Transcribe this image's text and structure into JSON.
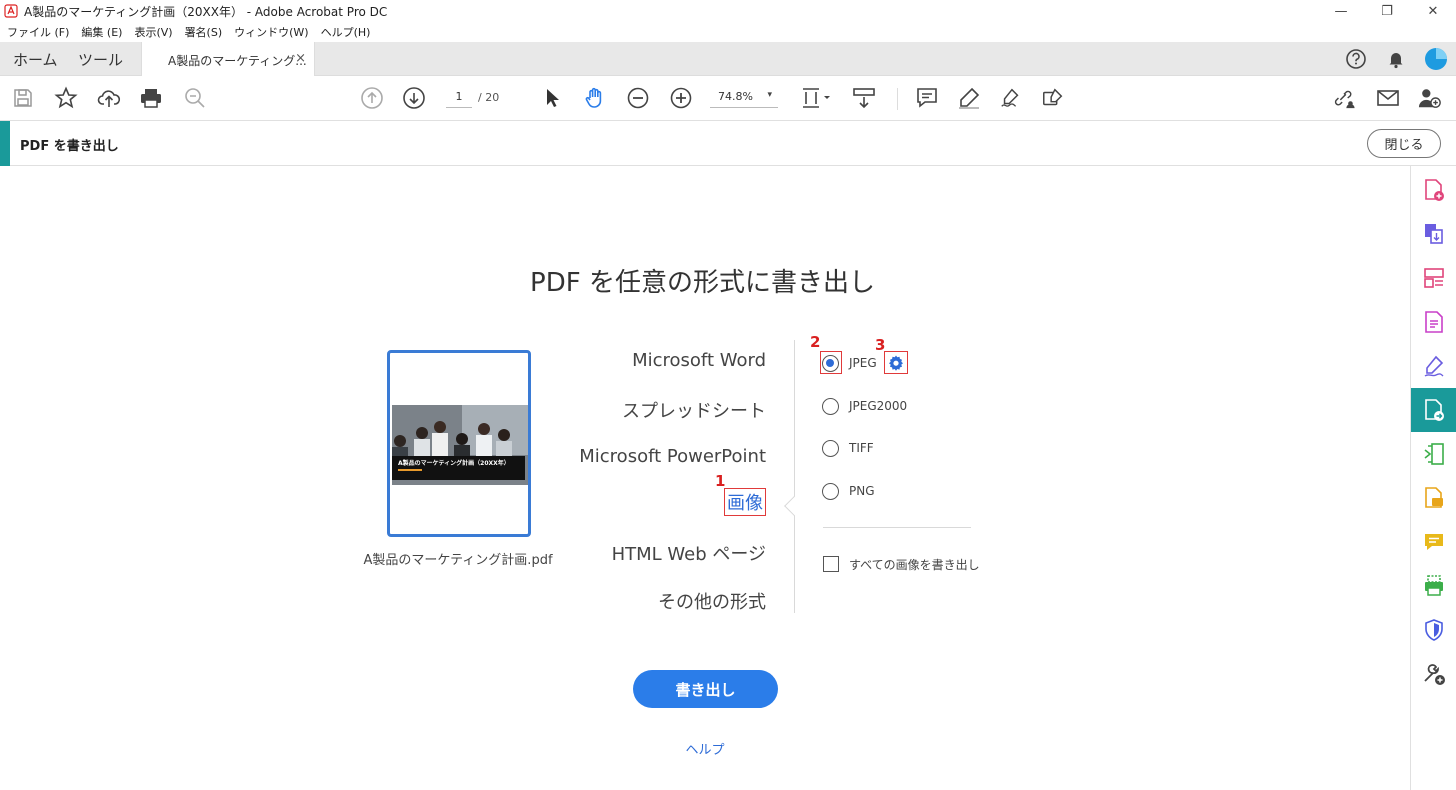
{
  "window": {
    "title": "A製品のマーケティング計画（20XX年） - Adobe Acrobat Pro DC",
    "minimize": "—",
    "restore": "❐",
    "close": "✕"
  },
  "menu": [
    "ファイル (F)",
    "編集 (E)",
    "表示(V)",
    "署名(S)",
    "ウィンドウ(W)",
    "ヘルプ(H)"
  ],
  "tabs": {
    "home": "ホーム",
    "tools": "ツール",
    "doc": "A製品のマーケティング...",
    "doc_close": "×"
  },
  "toolbar": {
    "page_current": "1",
    "page_total": "/ 20",
    "zoom": "74.8%",
    "zoom_arrow": "▾"
  },
  "export_panel": {
    "header_title": "PDF を書き出し",
    "close_label": "閉じる",
    "main_title": "PDF を任意の形式に書き出し",
    "file_name": "A製品のマーケティング計画.pdf",
    "thumb_title": "A製品のマーケティング計画（20XX年）",
    "formats": [
      "Microsoft Word",
      "スプレッドシート",
      "Microsoft PowerPoint",
      "画像",
      "HTML Web ページ",
      "その他の形式"
    ],
    "selected_format": "画像",
    "image_options": [
      "JPEG",
      "JPEG2000",
      "TIFF",
      "PNG"
    ],
    "selected_option": "JPEG",
    "export_all_images": "すべての画像を書き出し",
    "export_button": "書き出し",
    "help_link": "ヘルプ"
  },
  "annotations": [
    "1",
    "2",
    "3"
  ],
  "colors": {
    "accent_teal": "#1a9a9a",
    "primary_blue": "#2b7de9",
    "annotation_red": "#e03a3a"
  },
  "sidebar_icons": [
    "create-pdf-icon",
    "combine-files-icon",
    "organize-pages-icon",
    "edit-pdf-icon",
    "fill-sign-icon",
    "export-pdf-icon",
    "compress-pdf-icon",
    "comment-tool-icon",
    "comment-icon",
    "print-production-icon",
    "protect-icon",
    "more-tools-icon"
  ]
}
